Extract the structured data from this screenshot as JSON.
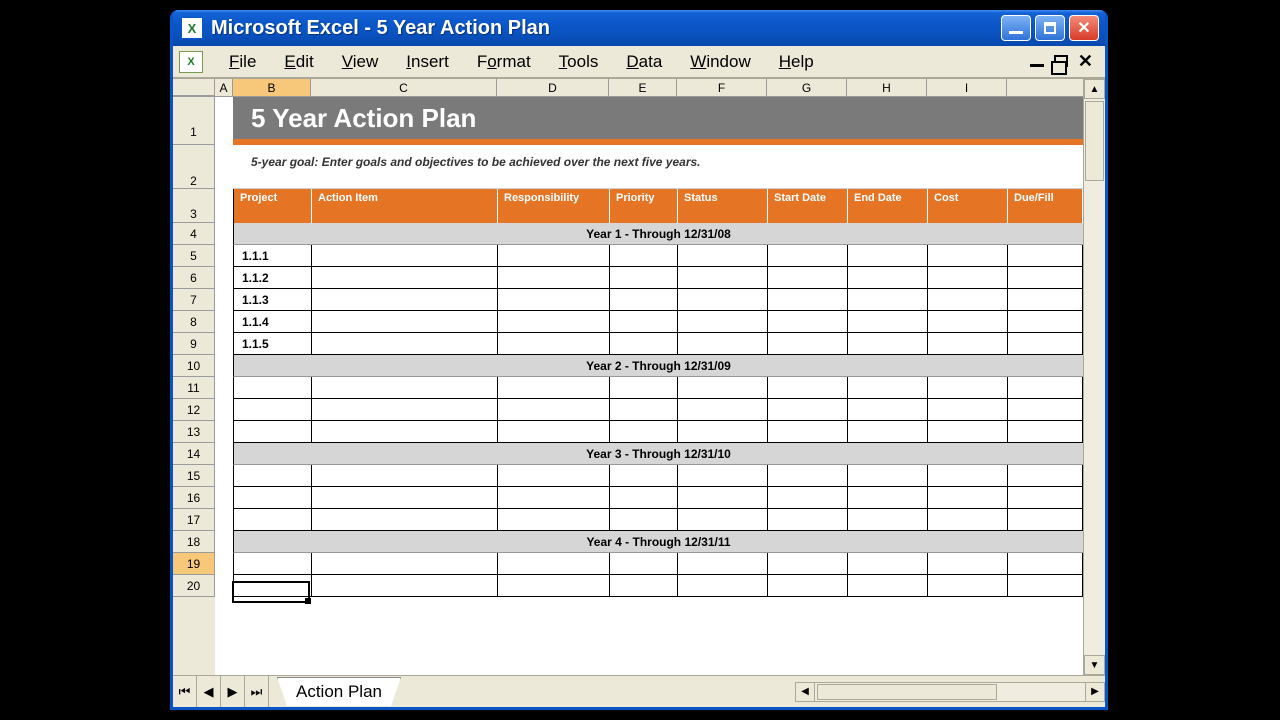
{
  "titlebar": {
    "text": "Microsoft Excel - 5 Year Action Plan"
  },
  "menu": {
    "file": "File",
    "edit": "Edit",
    "view": "View",
    "insert": "Insert",
    "format": "Format",
    "tools": "Tools",
    "data": "Data",
    "window": "Window",
    "help": "Help"
  },
  "columns": [
    "A",
    "B",
    "C",
    "D",
    "E",
    "F",
    "G",
    "H",
    "I"
  ],
  "rows": [
    "1",
    "2",
    "3",
    "4",
    "5",
    "6",
    "7",
    "8",
    "9",
    "10",
    "11",
    "12",
    "13",
    "14",
    "15",
    "16",
    "17",
    "18",
    "19",
    "20"
  ],
  "sheet": {
    "title": "5 Year Action Plan",
    "goal_text": "5-year goal: Enter goals and objectives to be achieved over the next five years.",
    "headers": {
      "project": "Project",
      "action_item": "Action Item",
      "responsibility": "Responsibility",
      "priority": "Priority",
      "status": "Status",
      "start_date": "Start Date",
      "end_date": "End Date",
      "cost": "Cost",
      "due_fill": "Due/Fill"
    },
    "year_labels": {
      "y1": "Year 1 - Through 12/31/08",
      "y2": "Year 2 - Through 12/31/09",
      "y3": "Year 3 - Through 12/31/10",
      "y4": "Year 4 - Through 12/31/11"
    },
    "year1_items": [
      "1.1.1",
      "1.1.2",
      "1.1.3",
      "1.1.4",
      "1.1.5"
    ]
  },
  "tab": {
    "name": "Action Plan"
  },
  "selection": {
    "cell": "B19"
  }
}
